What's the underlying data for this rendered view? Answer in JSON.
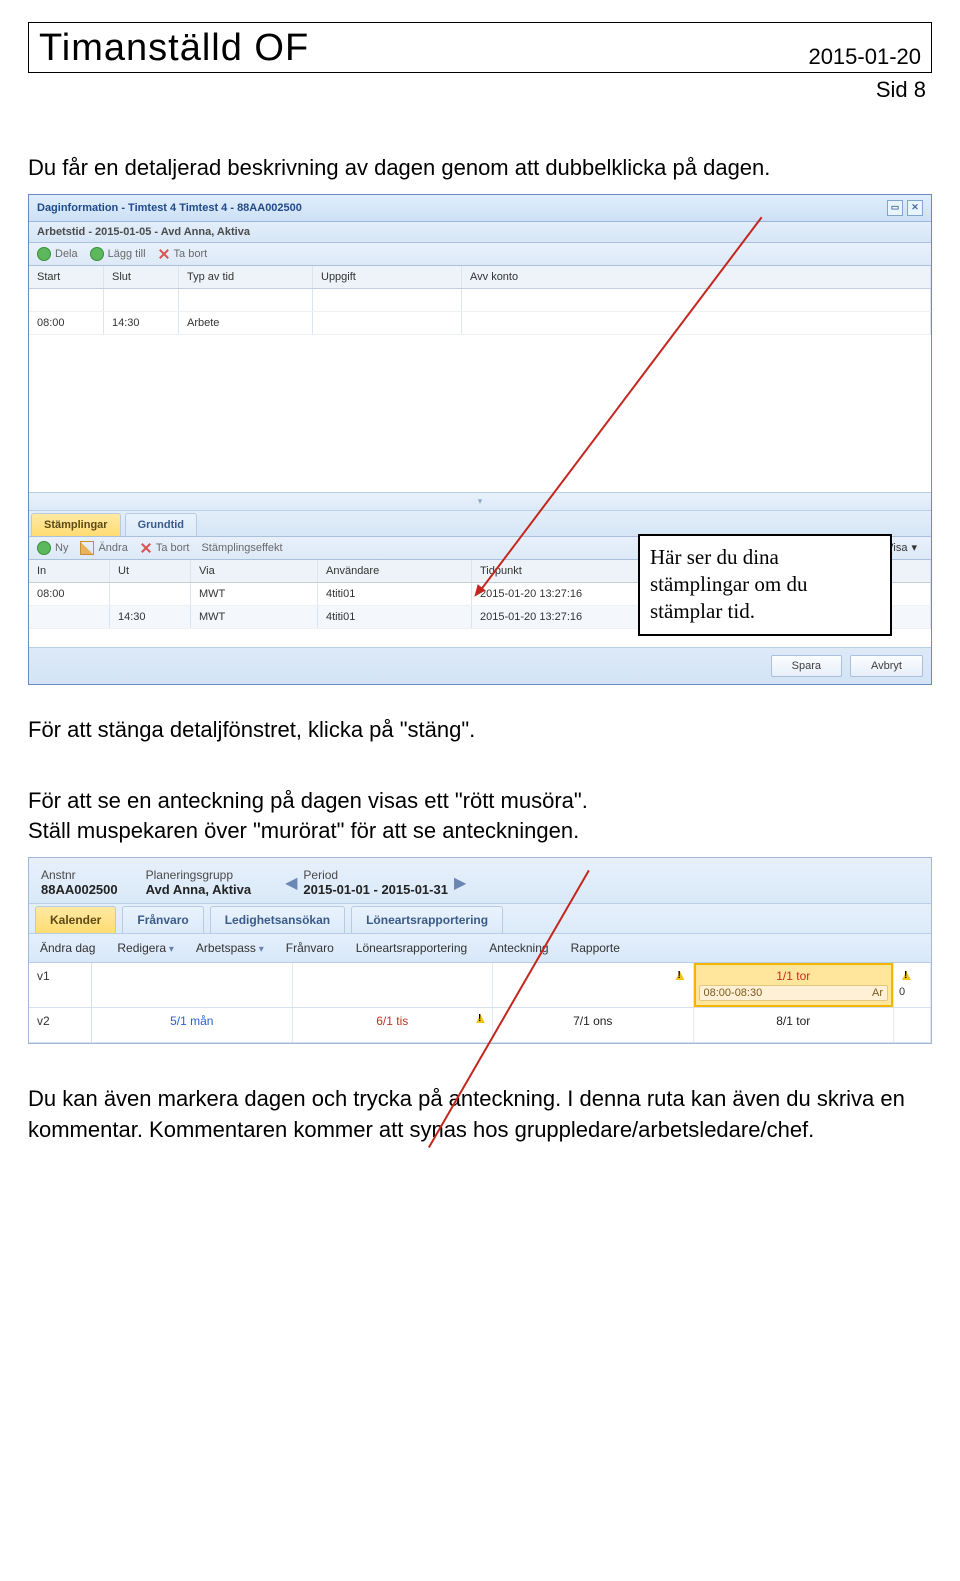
{
  "header": {
    "title": "Timanställd  OF",
    "date": "2015-01-20",
    "page": "Sid 8"
  },
  "intro": "Du får en detaljerad beskrivning av dagen genom att dubbelklicka på dagen.",
  "panel": {
    "title": "Daginformation - Timtest 4 Timtest 4 - 88AA002500",
    "subtitle": "Arbetstid - 2015-01-05 - Avd Anna, Aktiva",
    "toolbar1": {
      "dela": "Dela",
      "lagg": "Lägg till",
      "tabort": "Ta bort"
    },
    "grid1": {
      "headers": {
        "start": "Start",
        "slut": "Slut",
        "typ": "Typ av tid",
        "uppgift": "Uppgift",
        "avv": "Avv konto"
      },
      "row": {
        "start": "08:00",
        "slut": "14:30",
        "typ": "Arbete"
      }
    },
    "tabsA": {
      "stamplingar": "Stämplingar",
      "grundtid": "Grundtid"
    },
    "toolbar2": {
      "ny": "Ny",
      "andra": "Ändra",
      "tabort": "Ta bort",
      "effekt": "Stämplingseffekt",
      "visa": "Visa"
    },
    "grid2": {
      "headers": {
        "in": "In",
        "ut": "Ut",
        "via": "Via",
        "anvandare": "Användare",
        "tidpunkt": "Tidpunkt"
      },
      "rows": [
        {
          "in": "08:00",
          "ut": "",
          "via": "MWT",
          "anv": "4titi01",
          "tid": "2015-01-20 13:27:16"
        },
        {
          "in": "",
          "ut": "14:30",
          "via": "MWT",
          "anv": "4titi01",
          "tid": "2015-01-20 13:27:16"
        }
      ]
    },
    "buttons": {
      "spara": "Spara",
      "avbryt": "Avbryt"
    }
  },
  "callout": "Här ser du dina stämplingar om du stämplar tid.",
  "text2": "För att stänga detaljfönstret, klicka på \"stäng\".",
  "text3a": "För att se en anteckning på dagen visas ett \"rött musöra\".",
  "text3b": "Ställ muspekaren över \"murörat\" för att se anteckningen.",
  "panel2": {
    "fields": {
      "anstnr_l": "Anstnr",
      "anstnr": "88AA002500",
      "plgrp_l": "Planeringsgrupp",
      "plgrp": "Avd Anna, Aktiva",
      "period_l": "Period",
      "period": "2015-01-01 - 2015-01-31"
    },
    "tabs": {
      "kalender": "Kalender",
      "franvaro": "Frånvaro",
      "ledighet": "Ledighetsansökan",
      "loneart": "Löneartsrapportering"
    },
    "menu": {
      "andra": "Ändra dag",
      "redigera": "Redigera",
      "arbetspass": "Arbetspass",
      "franvaro": "Frånvaro",
      "loneart": "Löneartsrapportering",
      "anteckning": "Anteckning",
      "rapport": "Rapporte"
    },
    "cal": {
      "v1": "v1",
      "v2": "v2",
      "d_11": "1/1 tor",
      "tb_time": "08:00-08:30",
      "tb_label": "Ar",
      "d_51": "5/1 mån",
      "d_61": "6/1 tis",
      "d_71": "7/1 ons",
      "d_81": "8/1 tor"
    }
  },
  "text4": "Du kan även markera dagen och trycka på anteckning. I denna ruta kan även du skriva en kommentar. Kommentaren kommer att synas hos gruppledare/arbetsledare/chef."
}
